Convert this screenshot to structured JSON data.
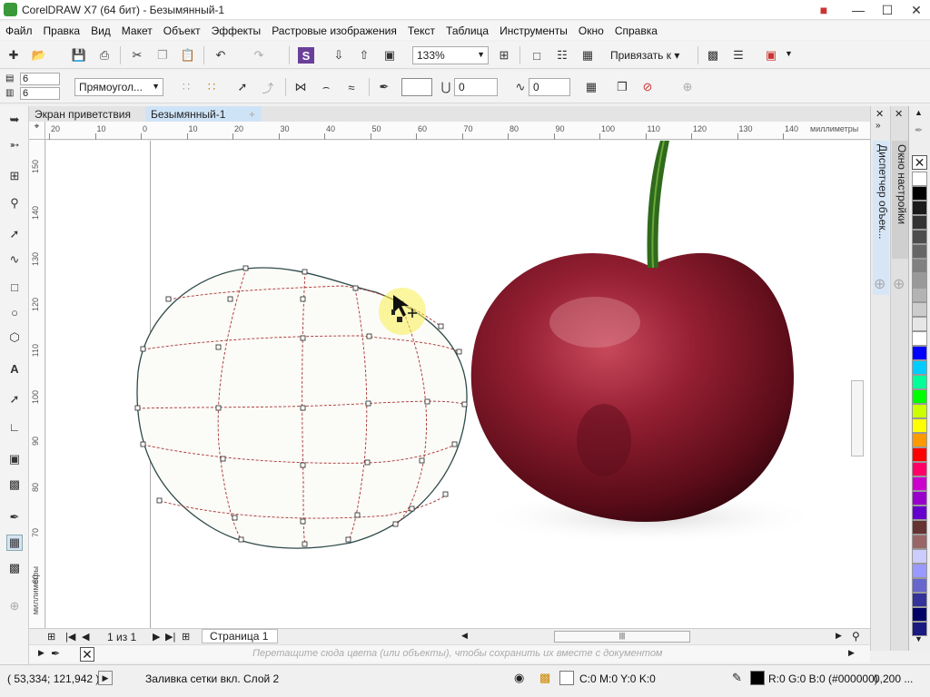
{
  "window": {
    "title": "CorelDRAW X7 (64 бит) - Безымянный-1"
  },
  "menu": [
    "Файл",
    "Правка",
    "Вид",
    "Макет",
    "Объект",
    "Эффекты",
    "Растровые изображения",
    "Текст",
    "Таблица",
    "Инструменты",
    "Окно",
    "Справка"
  ],
  "toolbar": {
    "zoom": "133%",
    "snap_label": "Привязать к"
  },
  "propbar": {
    "rows": "6",
    "cols": "6",
    "shape_mode": "Прямоугол...",
    "outline_value": "0",
    "corner_value": "0"
  },
  "tabs": [
    "Экран приветствия",
    "Безымянный-1"
  ],
  "ruler": {
    "h_ticks": [
      "20",
      "10",
      "0",
      "10",
      "20",
      "30",
      "40",
      "50",
      "60",
      "70",
      "80",
      "90",
      "100",
      "110",
      "120",
      "130",
      "140"
    ],
    "v_ticks": [
      "150",
      "140",
      "130",
      "120",
      "110",
      "100",
      "90",
      "80",
      "70",
      "60"
    ],
    "unit": "миллиметры"
  },
  "docker": {
    "tab1": "Диспетчер объек...",
    "tab2": "Окно настройки"
  },
  "page_nav": {
    "counter": "1 из 1",
    "page_tab": "Страница 1"
  },
  "colorbar_hint": "Перетащите сюда цвета (или объекты), чтобы сохранить их вместе с документом",
  "status": {
    "coords": "( 53,334; 121,942 )",
    "message": "Заливка сетки вкл. Слой 2",
    "fill_info": "C:0 M:0 Y:0 K:0",
    "outline_info": "R:0 G:0 B:0 (#000000)",
    "outline_width": "0,200 ..."
  },
  "colors": {
    "accent": "#3a7bd5",
    "cherry": "#8c1d2c",
    "mesh_outline": "#2e4a4a",
    "mesh_lines": "#a83232"
  },
  "palette": [
    "#ffffff",
    "#000000",
    "#1a1a1a",
    "#333333",
    "#4d4d4d",
    "#666666",
    "#808080",
    "#999999",
    "#b3b3b3",
    "#cccccc",
    "#e6e6e6",
    "#ffffff",
    "#0000ff",
    "#00ccff",
    "#00ff99",
    "#00ff00",
    "#ccff00",
    "#ffff00",
    "#ff9900",
    "#ff0000",
    "#ff0066",
    "#cc00cc",
    "#9900cc",
    "#6600cc",
    "#663333",
    "#996666",
    "#ccccff",
    "#9999ff",
    "#6666cc",
    "#333399",
    "#000066",
    "#1a1a80"
  ]
}
